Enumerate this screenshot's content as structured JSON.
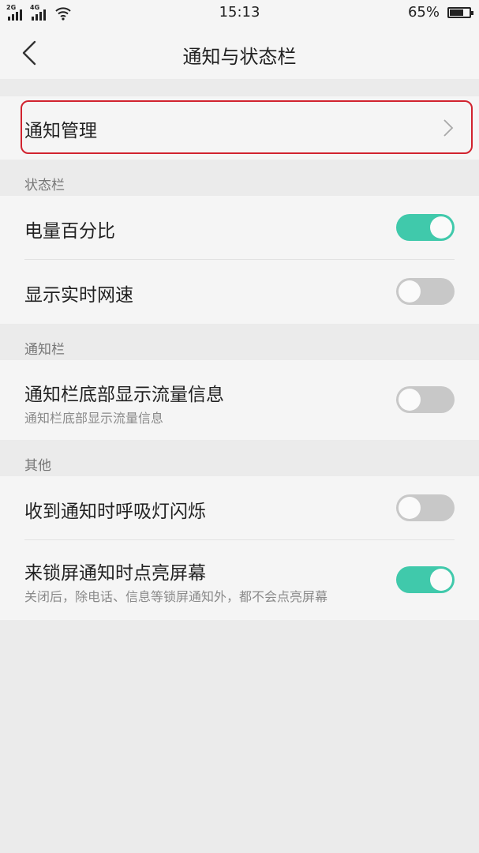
{
  "status_bar": {
    "sim1_label": "2G",
    "sim2_label": "4G",
    "time": "15:13",
    "battery_text": "65%",
    "battery_level": 0.65
  },
  "header": {
    "title": "通知与状态栏",
    "back_icon": "chevron-left-icon"
  },
  "notification_management": {
    "label": "通知管理",
    "chevron_icon": "chevron-right-icon",
    "highlight_color": "#d1232f"
  },
  "sections": {
    "status_bar_section": {
      "title": "状态栏",
      "items": [
        {
          "label": "电量百分比",
          "enabled": true
        },
        {
          "label": "显示实时网速",
          "enabled": false
        }
      ]
    },
    "notification_bar_section": {
      "title": "通知栏",
      "items": [
        {
          "label": "通知栏底部显示流量信息",
          "subtitle": "通知栏底部显示流量信息",
          "enabled": false
        }
      ]
    },
    "other_section": {
      "title": "其他",
      "items": [
        {
          "label": "收到通知时呼吸灯闪烁",
          "enabled": false
        },
        {
          "label": "来锁屏通知时点亮屏幕",
          "subtitle": "关闭后，除电话、信息等锁屏通知外，都不会点亮屏幕",
          "enabled": true
        }
      ]
    }
  },
  "colors": {
    "toggle_on": "#40c9ab",
    "toggle_off": "#c8c8c8",
    "background": "#ebebeb",
    "card": "#f5f5f5"
  }
}
